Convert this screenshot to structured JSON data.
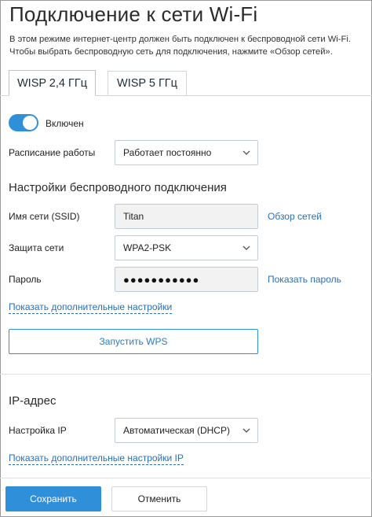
{
  "page": {
    "title": "Подключение к сети Wi-Fi",
    "description": "В этом режиме интернет-центр должен быть подключен к беспроводной сети Wi-Fi. Чтобы выбрать беспроводную сеть для подключения, нажмите «Обзор сетей»."
  },
  "tabs": [
    {
      "label": "WISP 2,4 ГГц",
      "active": true
    },
    {
      "label": "WISP 5 ГГц",
      "active": false
    }
  ],
  "toggle": {
    "label": "Включен",
    "on": true
  },
  "schedule": {
    "label": "Расписание работы",
    "value": "Работает постоянно",
    "icon": "chevron-down-icon"
  },
  "wireless_section": {
    "title": "Настройки беспроводного подключения",
    "ssid": {
      "label": "Имя сети (SSID)",
      "value": "Titan",
      "link": "Обзор сетей"
    },
    "security": {
      "label": "Защита сети",
      "value": "WPA2-PSK",
      "icon": "chevron-down-icon"
    },
    "password": {
      "label": "Пароль",
      "value": "●●●●●●●●●●●",
      "link": "Показать пароль"
    },
    "more_link": "Показать дополнительные настройки",
    "wps_button": "Запустить WPS"
  },
  "ip_section": {
    "title": "IP-адрес",
    "ip_setting": {
      "label": "Настройка IP",
      "value": "Автоматическая (DHCP)",
      "icon": "chevron-down-icon"
    },
    "more_link": "Показать дополнительные настройки IP"
  },
  "footer": {
    "save": "Сохранить",
    "cancel": "Отменить"
  },
  "colors": {
    "accent": "#2f8fd8",
    "link": "#2a6fb5"
  }
}
